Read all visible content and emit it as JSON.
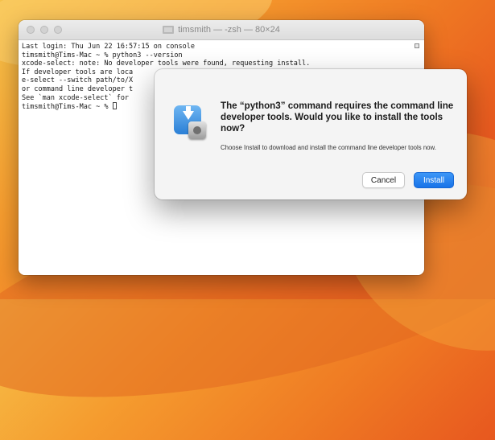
{
  "window": {
    "title": "timsmith — -zsh — 80×24",
    "title_icon": "folder-icon"
  },
  "terminal": {
    "lines": [
      "Last login: Thu Jun 22 16:57:15 on console",
      "timsmith@Tims-Mac ~ % python3 --version",
      "xcode-select: note: No developer tools were found, requesting install.",
      "If developer tools are loca",
      "e-select --switch path/to/X",
      "or command line developer t",
      "See `man xcode-select` for",
      "timsmith@Tims-Mac ~ % "
    ]
  },
  "dialog": {
    "title": "The “python3” command requires the command line developer tools. Would you like to install the tools now?",
    "message": "Choose Install to download and install the command line developer tools now.",
    "cancel_label": "Cancel",
    "install_label": "Install",
    "accent_color": "#1a74e8"
  }
}
